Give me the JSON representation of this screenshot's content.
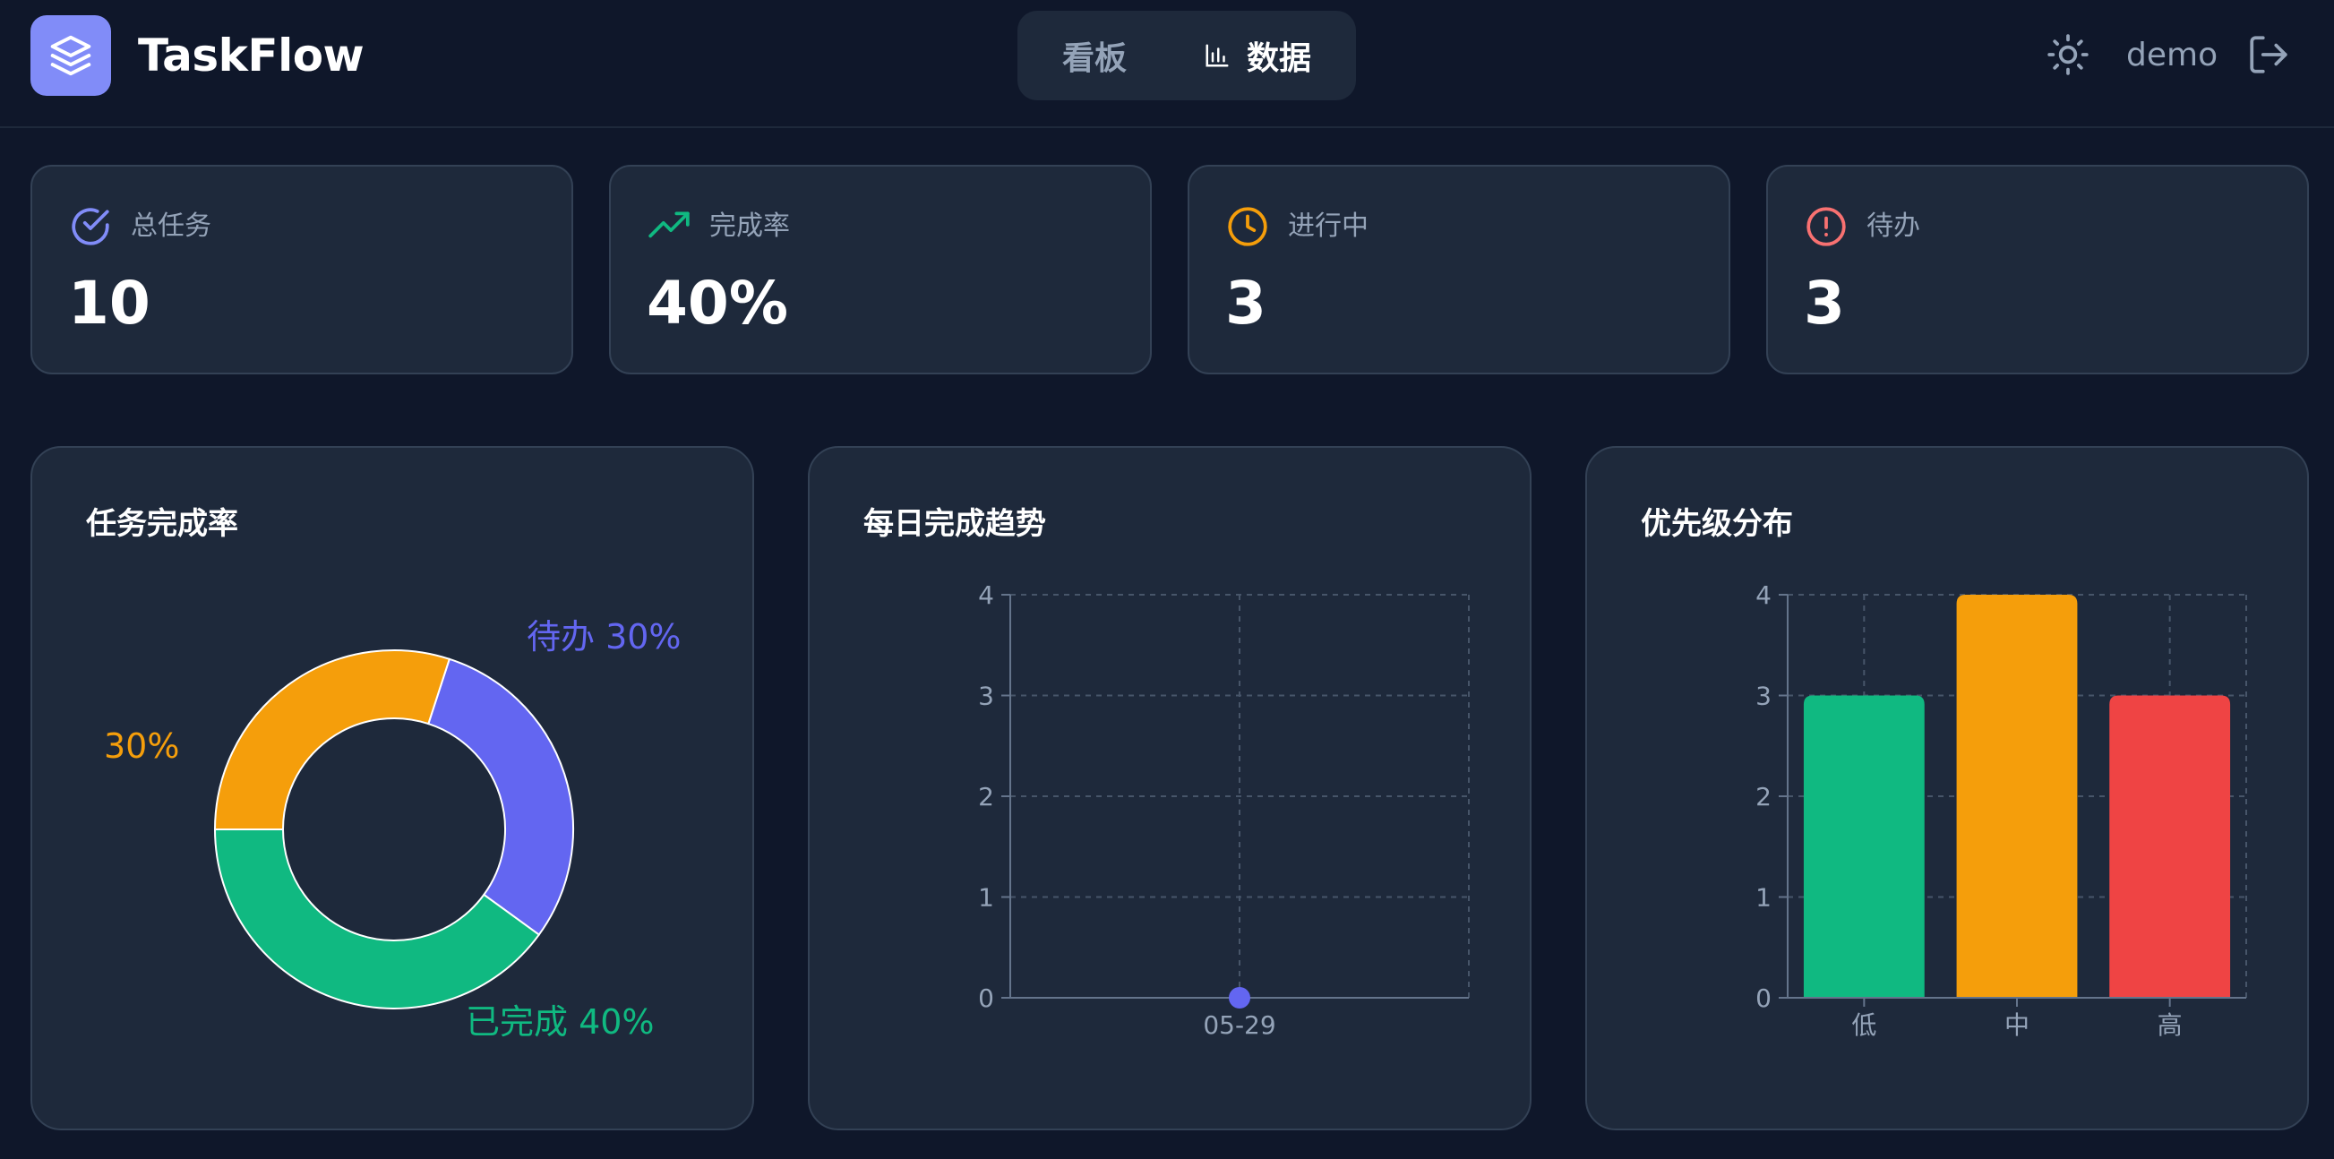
{
  "header": {
    "app_title": "TaskFlow",
    "tabs": [
      {
        "label": "看板",
        "active": false
      },
      {
        "label": "数据",
        "active": true
      }
    ],
    "user": "demo"
  },
  "stats": [
    {
      "label": "总任务",
      "value": "10",
      "icon": "check-circle-icon",
      "color": "#818cf8"
    },
    {
      "label": "完成率",
      "value": "40%",
      "icon": "trending-up-icon",
      "color": "#10b981"
    },
    {
      "label": "进行中",
      "value": "3",
      "icon": "clock-icon",
      "color": "#f59e0b"
    },
    {
      "label": "待办",
      "value": "3",
      "icon": "alert-circle-icon",
      "color": "#ef4444"
    }
  ],
  "charts": {
    "completion": {
      "title": "任务完成率"
    },
    "trend": {
      "title": "每日完成趋势"
    },
    "priority": {
      "title": "优先级分布"
    }
  },
  "chart_data": [
    {
      "type": "pie",
      "title": "任务完成率",
      "donut": true,
      "slices": [
        {
          "label": "待办",
          "value": 30,
          "color": "#6366f1",
          "display": "待办 30%"
        },
        {
          "label": "已完成",
          "value": 40,
          "color": "#10b981",
          "display": "已完成 40%"
        },
        {
          "label": "",
          "value": 30,
          "color": "#f59e0b",
          "display": "30%"
        }
      ]
    },
    {
      "type": "line",
      "title": "每日完成趋势",
      "categories": [
        "05-29"
      ],
      "series": [
        {
          "values": [
            0
          ],
          "color": "#6366f1"
        }
      ],
      "ylim": [
        0,
        4
      ],
      "yticks": [
        0,
        1,
        2,
        3,
        4
      ],
      "grid": true
    },
    {
      "type": "bar",
      "title": "优先级分布",
      "categories": [
        "低",
        "中",
        "高"
      ],
      "values": [
        3,
        4,
        3
      ],
      "colors": [
        "#10b981",
        "#f59e0b",
        "#ef4444"
      ],
      "ylim": [
        0,
        4
      ],
      "yticks": [
        0,
        1,
        2,
        3,
        4
      ],
      "grid": true
    }
  ]
}
